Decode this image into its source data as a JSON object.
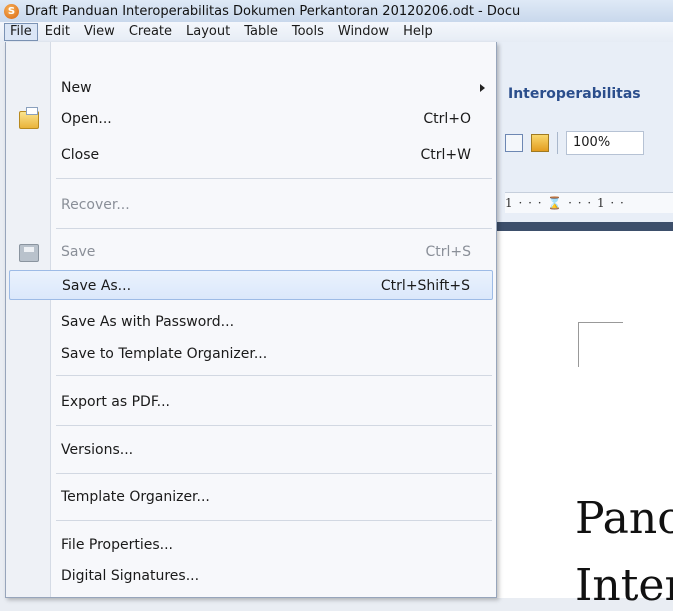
{
  "window": {
    "title": "Draft Panduan Interoperabilitas Dokumen Perkantoran 20120206.odt - Docu"
  },
  "menubar": {
    "items": [
      "File",
      "Edit",
      "View",
      "Create",
      "Layout",
      "Table",
      "Tools",
      "Window",
      "Help"
    ],
    "active": "File"
  },
  "file_menu": {
    "new": {
      "label": "New",
      "has_submenu": true
    },
    "open": {
      "label": "Open...",
      "shortcut": "Ctrl+O",
      "icon": "open-folder-icon"
    },
    "close": {
      "label": "Close",
      "shortcut": "Ctrl+W"
    },
    "recover": {
      "label": "Recover...",
      "disabled": true
    },
    "save": {
      "label": "Save",
      "shortcut": "Ctrl+S",
      "disabled": true,
      "icon": "floppy-disk-icon"
    },
    "save_as": {
      "label": "Save As...",
      "shortcut": "Ctrl+Shift+S",
      "highlighted": true
    },
    "save_as_password": {
      "label": "Save As with Password..."
    },
    "save_to_template": {
      "label": "Save to Template Organizer..."
    },
    "export_pdf": {
      "label": "Export as PDF..."
    },
    "versions": {
      "label": "Versions..."
    },
    "template_organizer": {
      "label": "Template Organizer..."
    },
    "file_properties": {
      "label": "File Properties..."
    },
    "digital_signatures": {
      "label": "Digital Signatures..."
    }
  },
  "document": {
    "tab_title": "Interoperabilitas",
    "zoom": "100%",
    "ruler_text": "1 · · · ⌛ · · · 1 · ·",
    "body_line1": "Panc",
    "body_line2": "Inter"
  },
  "colors": {
    "menu_highlight": "#dbe8fb",
    "doc_title_blue": "#2b4e8c"
  }
}
